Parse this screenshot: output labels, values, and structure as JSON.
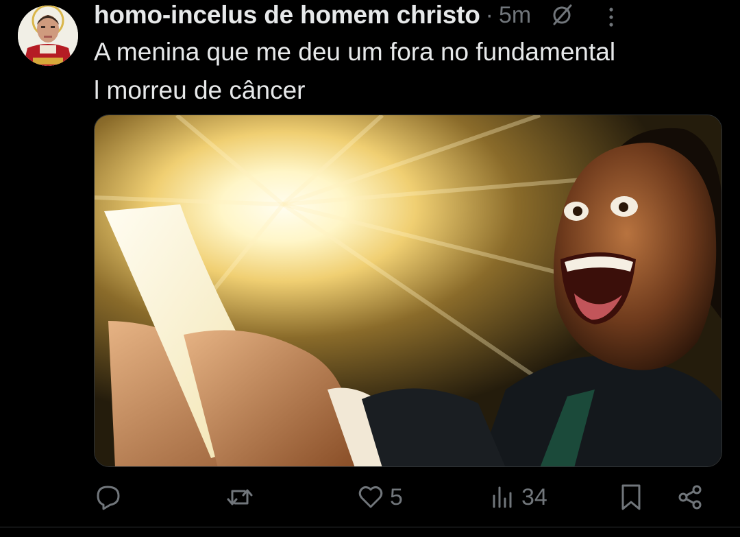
{
  "post": {
    "author": {
      "display_name": "homo-incelus de homem christo",
      "avatar_icon": "user-avatar"
    },
    "separator": "·",
    "timestamp": "5m",
    "text_lines": [
      "A menina que me deu um fora no fundamental",
      "l morreu de câncer"
    ],
    "media": {
      "description_icon": "meme-image"
    },
    "actions": {
      "reply": {
        "icon": "reply-icon",
        "count": ""
      },
      "repost": {
        "icon": "repost-icon",
        "count": ""
      },
      "like": {
        "icon": "heart-icon",
        "count": "5"
      },
      "views": {
        "icon": "views-icon",
        "count": "34"
      },
      "bookmark": {
        "icon": "bookmark-icon"
      },
      "share": {
        "icon": "share-icon"
      }
    }
  },
  "colors": {
    "background": "#000000",
    "text": "#e7e9ea",
    "muted": "#71767b"
  }
}
